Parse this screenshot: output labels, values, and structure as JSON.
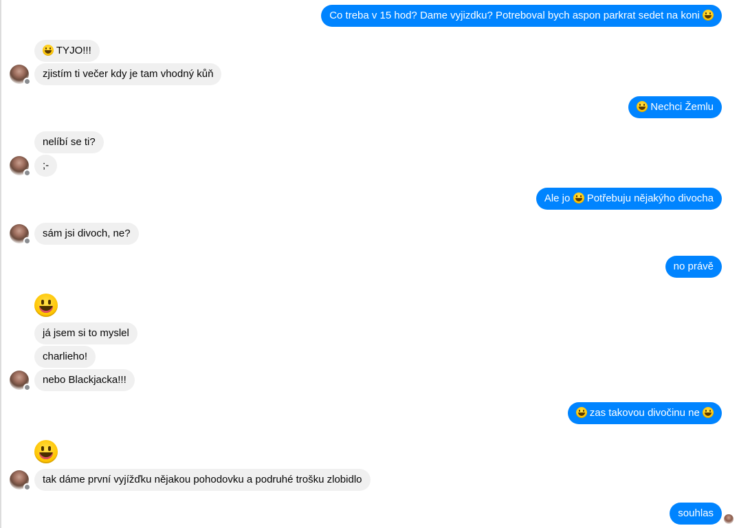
{
  "conversation": {
    "messages": [
      {
        "id": "m1",
        "side": "out",
        "parts": [
          "Co treba v 15 hod? Dame vyjizdku? Potreboval bych aspon parkrat sedet na koni ",
          ":emoji:"
        ]
      },
      {
        "id": "m2",
        "side": "in",
        "parts": [
          ":emoji:",
          " TYJO!!!"
        ]
      },
      {
        "id": "m3",
        "side": "in",
        "text": "zjistím ti večer kdy je tam vhodný kůň"
      },
      {
        "id": "m4",
        "side": "out",
        "parts": [
          ":emoji:",
          " Nechci Žemlu"
        ]
      },
      {
        "id": "m5",
        "side": "in",
        "text": "nelíbí se ti?"
      },
      {
        "id": "m6",
        "side": "in",
        "text": ";-"
      },
      {
        "id": "m7",
        "side": "out",
        "parts": [
          "Ale jo ",
          ":emoji:",
          " Potřebuju nějakýho divocha"
        ]
      },
      {
        "id": "m8",
        "side": "in",
        "text": "sám jsi divoch, ne?"
      },
      {
        "id": "m9",
        "side": "out",
        "text": "no právě"
      },
      {
        "id": "m10",
        "side": "in",
        "text": "já jsem si to myslel"
      },
      {
        "id": "m11",
        "side": "in",
        "text": "charlieho!"
      },
      {
        "id": "m12",
        "side": "in",
        "text": "nebo Blackjacka!!!"
      },
      {
        "id": "m13",
        "side": "out",
        "parts": [
          ":emoji:",
          " zas takovou divočinu ne ",
          ":emoji:"
        ]
      },
      {
        "id": "m14",
        "side": "in",
        "text": "tak dáme první vyjížďku nějakou pohodovku a podruhé trošku zlobidlo"
      },
      {
        "id": "m15",
        "side": "out",
        "text": "souhlas"
      }
    ],
    "emoji_name": "grinning-face-emoji",
    "badge_icon": "messenger-badge-icon"
  },
  "colors": {
    "outgoing_bubble": "#0084ff",
    "incoming_bubble": "#f0f0f0",
    "outgoing_text": "#ffffff",
    "incoming_text": "#050505"
  }
}
